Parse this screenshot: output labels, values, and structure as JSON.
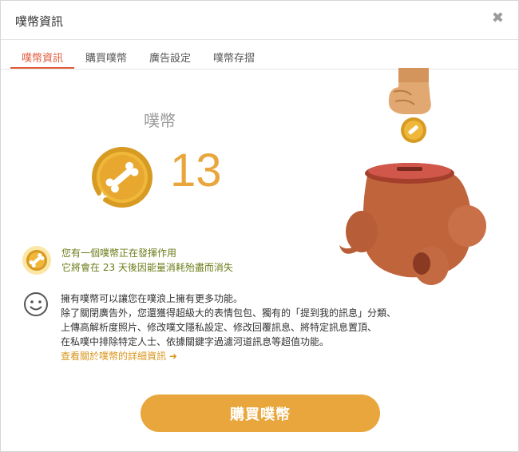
{
  "dialog": {
    "title": "噗幣資訊"
  },
  "tabs": [
    {
      "label": "噗幣資訊"
    },
    {
      "label": "購買噗幣"
    },
    {
      "label": "廣告設定"
    },
    {
      "label": "噗幣存摺"
    }
  ],
  "coins": {
    "label": "噗幣",
    "count": "13"
  },
  "status": {
    "line1": "您有一個噗幣正在發揮作用",
    "line2": "它將會在 23 天後因能量消耗殆盡而消失"
  },
  "info": {
    "line1": "擁有噗幣可以讓您在噗浪上擁有更多功能。",
    "line2": "除了關閉廣告外，您還獲得超級大的表情包包、獨有的「提到我的訊息」分類、",
    "line3": "上傳高解析度照片、修改噗文隱私設定、修改回覆訊息、將特定訊息置頂、",
    "line4": "在私噗中排除特定人士、依據關鍵字過濾河道訊息等超值功能。",
    "link": "查看關於噗幣的詳細資訊"
  },
  "buy_button": "購買噗幣",
  "colors": {
    "accent": "#e05a3a",
    "gold": "#e8a63d",
    "status_green": "#6b7d1a",
    "link": "#d9961c"
  }
}
